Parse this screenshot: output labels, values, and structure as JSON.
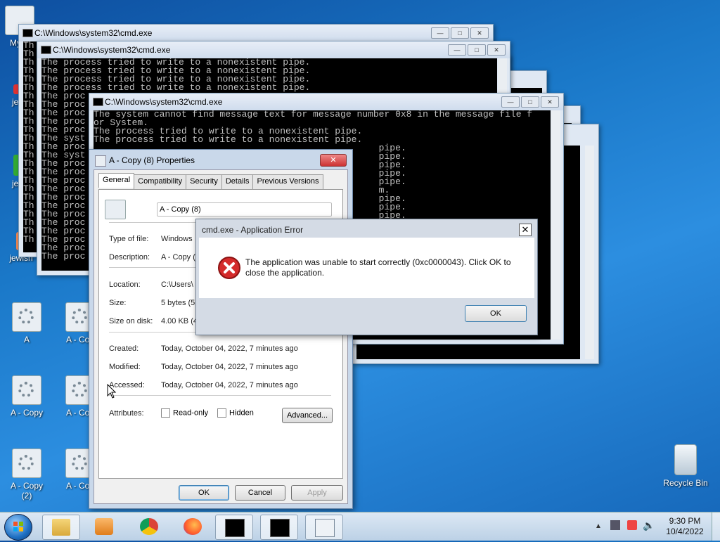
{
  "desktop": {
    "icons": [
      {
        "label": "My C"
      },
      {
        "label": "jew"
      },
      {
        "label": "jew"
      },
      {
        "label": "jewish"
      },
      {
        "label": "A"
      },
      {
        "label": "A - Cop"
      },
      {
        "label": "A - Copy"
      },
      {
        "label": "A - Cop"
      },
      {
        "label": "A - Copy (2)"
      },
      {
        "label": "A - Cop"
      },
      {
        "label": "Recycle Bin"
      }
    ]
  },
  "cmd": {
    "title": "C:\\Windows\\system32\\cmd.exe",
    "lines_back": "Th\nTh\nTh\nTh\nTh\nTh\nTh\nTh\nTh\nTh\nTh\nTh\nTh\nTh\nTh\nTh\nTh\nTh\nTh\nTh\nTh\nTh\nTh\nTh",
    "lines_mid": "The process tried to write to a nonexistent pipe.\nThe process tried to write to a nonexistent pipe.\nThe process tried to write to a nonexistent pipe.\nThe process tried to write to a nonexistent pipe.\nThe proc\nThe proc\nThe proc\nThe proc\nThe proc\nThe syst\nThe proc\nThe syst\nThe proc\nThe proc\nThe proc\nThe proc\nThe proc\nThe proc\nThe proc\nThe proc\nThe proc\nThe proc\nThe proc\nThe proc",
    "lines_front": "The system cannot find message text for message number 0x8 in the message file f\nor System.\nThe process tried to write to a nonexistent pipe.\nThe process tried to write to a nonexistent pipe.\n                                                    pipe.\n                                                    pipe.\n                                                    pipe.\n                                                    pipe.\n                                                    pipe.\n                                                    m.\n                                                    pipe.\n                                                    pipe.\n                                                    pipe.\n                                                    pipe."
  },
  "props": {
    "title": "A - Copy (8) Properties",
    "tabs": [
      "General",
      "Compatibility",
      "Security",
      "Details",
      "Previous Versions"
    ],
    "filename": "A - Copy (8)",
    "type_label": "Type of file:",
    "type_value": "Windows",
    "desc_label": "Description:",
    "desc_value": "A - Copy (",
    "loc_label": "Location:",
    "loc_value": "C:\\Users\\",
    "size_label": "Size:",
    "size_value": "5 bytes (5",
    "sod_label": "Size on disk:",
    "sod_value": "4.00 KB (4",
    "created_label": "Created:",
    "created_value": "Today, October 04, 2022, 7 minutes ago",
    "modified_label": "Modified:",
    "modified_value": "Today, October 04, 2022, 7 minutes ago",
    "accessed_label": "Accessed:",
    "accessed_value": "Today, October 04, 2022, 7 minutes ago",
    "attr_label": "Attributes:",
    "readonly": "Read-only",
    "hidden": "Hidden",
    "advanced": "Advanced...",
    "ok": "OK",
    "cancel": "Cancel",
    "apply": "Apply"
  },
  "error": {
    "title": "cmd.exe - Application Error",
    "message": "The application was unable to start correctly (0xc0000043). Click OK to close the application.",
    "ok": "OK"
  },
  "taskbar": {
    "time": "9:30 PM",
    "date": "10/4/2022"
  },
  "colors": {
    "error_red": "#d42b2b",
    "console_bg": "#000000",
    "console_fg": "#c0c0c0"
  }
}
